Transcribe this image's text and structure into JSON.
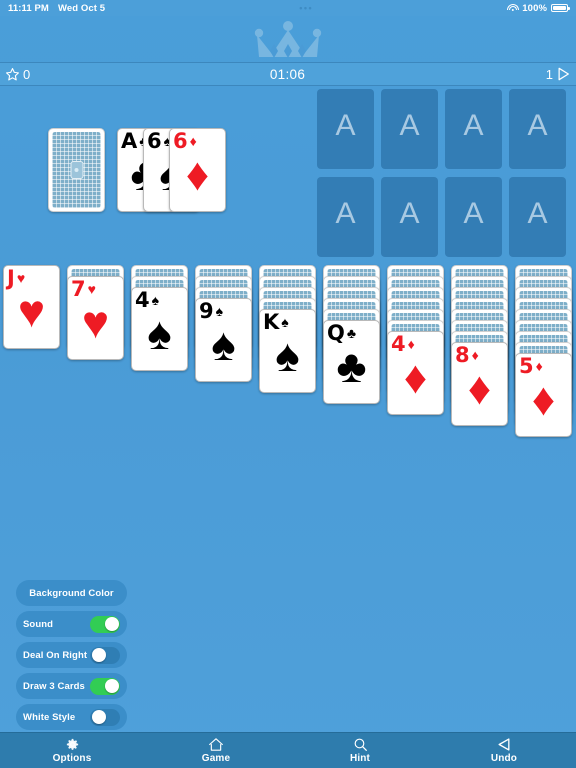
{
  "status_bar": {
    "time": "11:11 PM",
    "date": "Wed Oct 5",
    "dots": "•••",
    "battery_percent": "100%",
    "wifi_icon": "wifi-icon",
    "battery_icon": "battery-icon"
  },
  "header": {
    "crown_icon": "crown-icon"
  },
  "info_bar": {
    "star_icon": "star-icon",
    "score": "0",
    "timer": "01:06",
    "passes": "1",
    "next_icon": "play-triangle-icon"
  },
  "stock": {
    "name": "stock-pile",
    "face_down": true
  },
  "waste": {
    "name": "waste-pile",
    "cards": [
      {
        "rank": "A",
        "suit": "♣",
        "color": "black"
      },
      {
        "rank": "6",
        "suit": "♠",
        "color": "black"
      },
      {
        "rank": "6",
        "suit": "♦",
        "color": "red"
      }
    ]
  },
  "foundations": {
    "placeholder": "A",
    "slots": [
      {
        "name": "foundation-1"
      },
      {
        "name": "foundation-2"
      },
      {
        "name": "foundation-3"
      },
      {
        "name": "foundation-4"
      },
      {
        "name": "foundation-5"
      },
      {
        "name": "foundation-6"
      },
      {
        "name": "foundation-7"
      },
      {
        "name": "foundation-8"
      }
    ]
  },
  "tableau": {
    "columns": [
      {
        "hidden": 0,
        "rank": "J",
        "suit": "♥",
        "color": "red"
      },
      {
        "hidden": 1,
        "rank": "7",
        "suit": "♥",
        "color": "red"
      },
      {
        "hidden": 2,
        "rank": "4",
        "suit": "♠",
        "color": "black"
      },
      {
        "hidden": 3,
        "rank": "9",
        "suit": "♠",
        "color": "black"
      },
      {
        "hidden": 4,
        "rank": "K",
        "suit": "♠",
        "color": "black"
      },
      {
        "hidden": 5,
        "rank": "Q",
        "suit": "♣",
        "color": "black"
      },
      {
        "hidden": 6,
        "rank": "4",
        "suit": "♦",
        "color": "red"
      },
      {
        "hidden": 7,
        "rank": "8",
        "suit": "♦",
        "color": "red"
      },
      {
        "hidden": 8,
        "rank": "5",
        "suit": "♦",
        "color": "red"
      }
    ]
  },
  "settings": {
    "background_color_label": "Background Color",
    "rows": [
      {
        "label": "Sound",
        "on": true
      },
      {
        "label": "Deal On Right",
        "on": false
      },
      {
        "label": "Draw 3 Cards",
        "on": true
      },
      {
        "label": "White Style",
        "on": false
      }
    ]
  },
  "toolbar": {
    "items": [
      {
        "label": "Options",
        "icon": "gear-icon"
      },
      {
        "label": "Game",
        "icon": "home-icon"
      },
      {
        "label": "Hint",
        "icon": "magnifier-icon"
      },
      {
        "label": "Undo",
        "icon": "undo-triangle-icon"
      }
    ]
  },
  "colors": {
    "background": "#4a9bd6",
    "info_bar": "#4fa2da",
    "foundation": "#337db5",
    "toolbar": "#2e7cad",
    "toggle_on": "#32cd54",
    "card_red": "#ee1b24"
  }
}
